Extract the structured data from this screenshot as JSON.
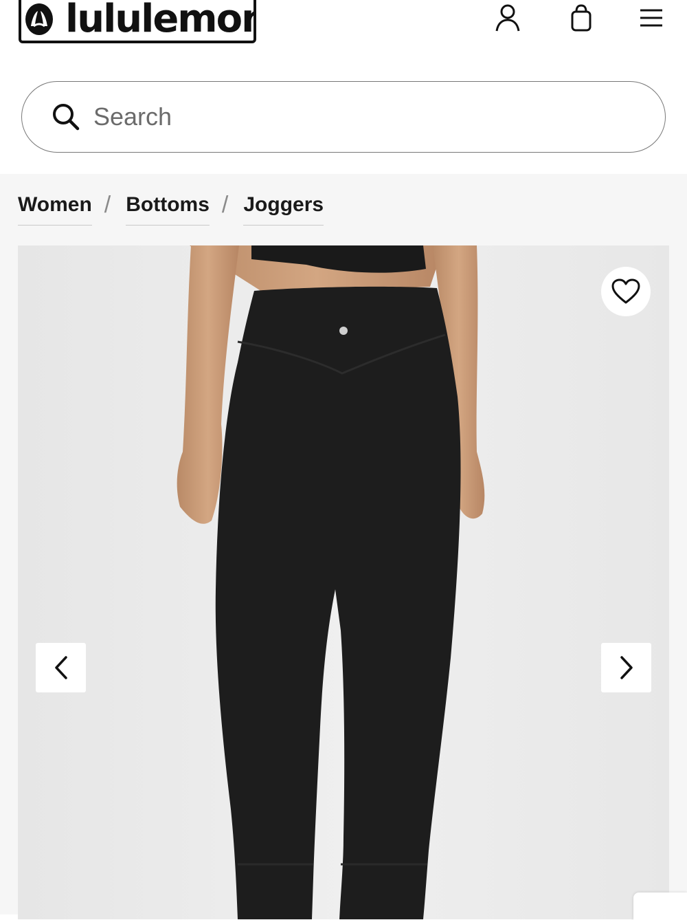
{
  "brand": {
    "name": "lululemon",
    "logo_icon": "lululemon-logo-mark"
  },
  "header": {
    "icons": [
      "account-icon",
      "bag-icon",
      "menu-icon"
    ]
  },
  "search": {
    "placeholder": "Search",
    "value": "",
    "icon": "search-icon"
  },
  "breadcrumb": {
    "items": [
      {
        "label": "Women"
      },
      {
        "label": "Bottoms"
      },
      {
        "label": "Joggers"
      }
    ],
    "separator": "/"
  },
  "product_gallery": {
    "image_subject": "product-photo-black-joggers",
    "favorite_icon": "heart-icon",
    "prev_icon": "chevron-left-icon",
    "next_icon": "chevron-right-icon"
  },
  "colors": {
    "text": "#1a1a1a",
    "page_bg": "#f6f6f6",
    "product_black": "#1c1c1c"
  }
}
